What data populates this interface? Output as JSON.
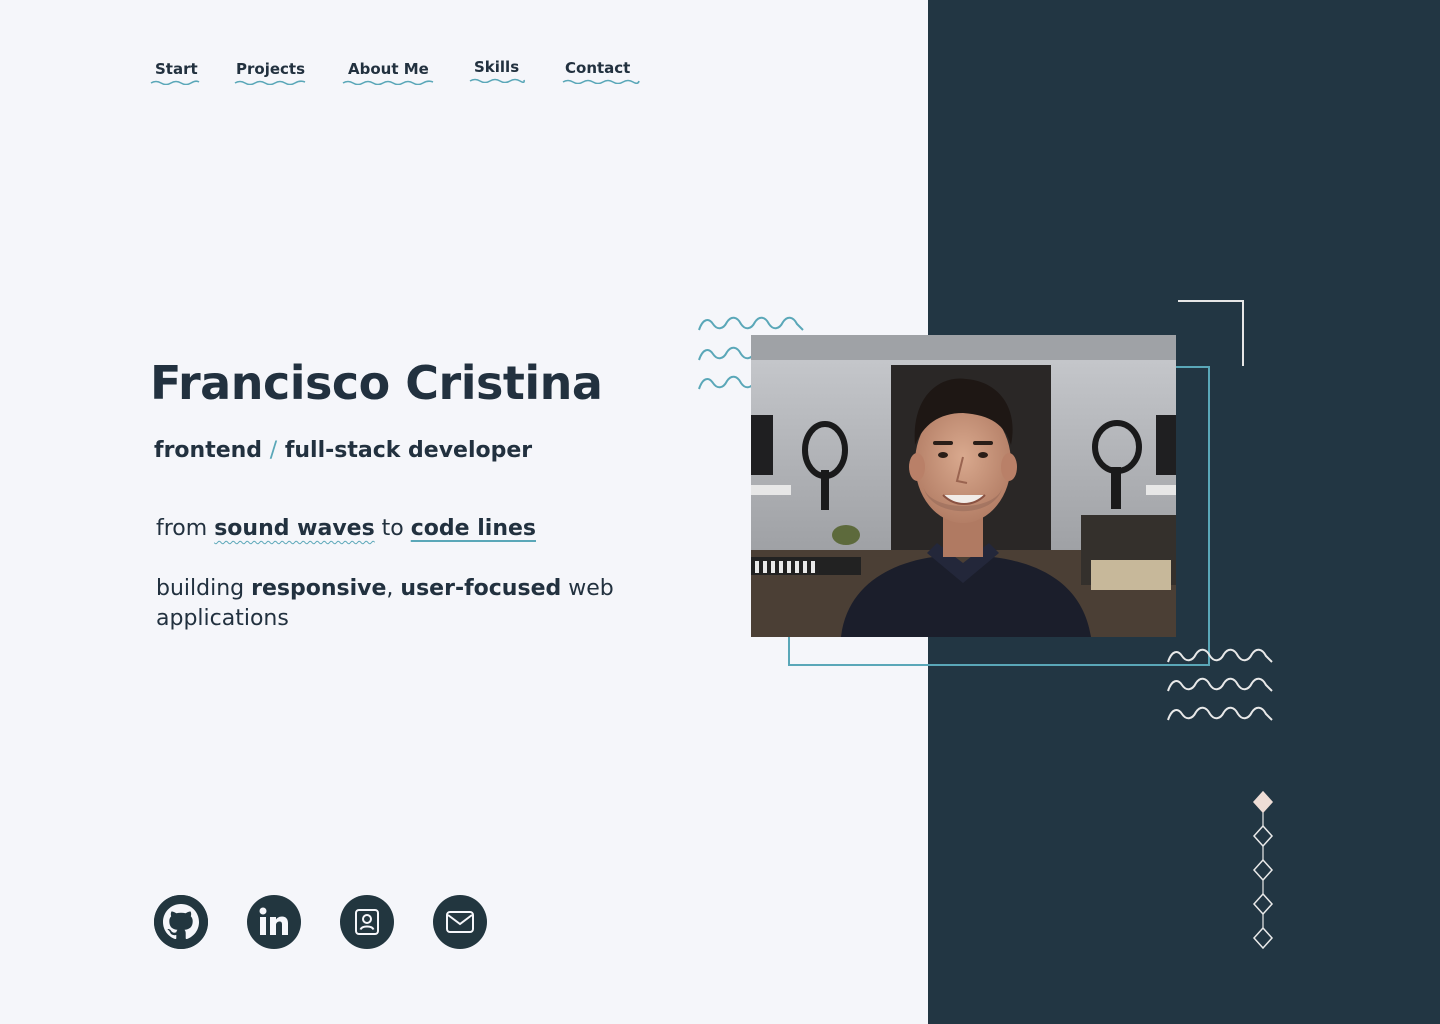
{
  "nav": {
    "items": [
      {
        "label": "Start"
      },
      {
        "label": "Projects"
      },
      {
        "label": "About Me"
      },
      {
        "label": "Skills"
      },
      {
        "label": "Contact"
      }
    ]
  },
  "hero": {
    "name": "Francisco Cristina",
    "role_part1": "frontend",
    "role_slash": "/",
    "role_part2": "full-stack developer",
    "tagline_from": "from ",
    "tagline_highlight1": "sound waves",
    "tagline_to": " to ",
    "tagline_highlight2": "code lines",
    "desc_building": "building ",
    "desc_bold1": "responsive",
    "desc_comma": ", ",
    "desc_bold2": "user-focused",
    "desc_rest": " web applications"
  },
  "social": [
    {
      "icon": "github-icon"
    },
    {
      "icon": "linkedin-icon"
    },
    {
      "icon": "contact-card-icon"
    },
    {
      "icon": "mail-icon"
    }
  ],
  "colors": {
    "background": "#f5f6fa",
    "panel": "#223643",
    "text": "#22313f",
    "accent": "#5aa7b8"
  }
}
